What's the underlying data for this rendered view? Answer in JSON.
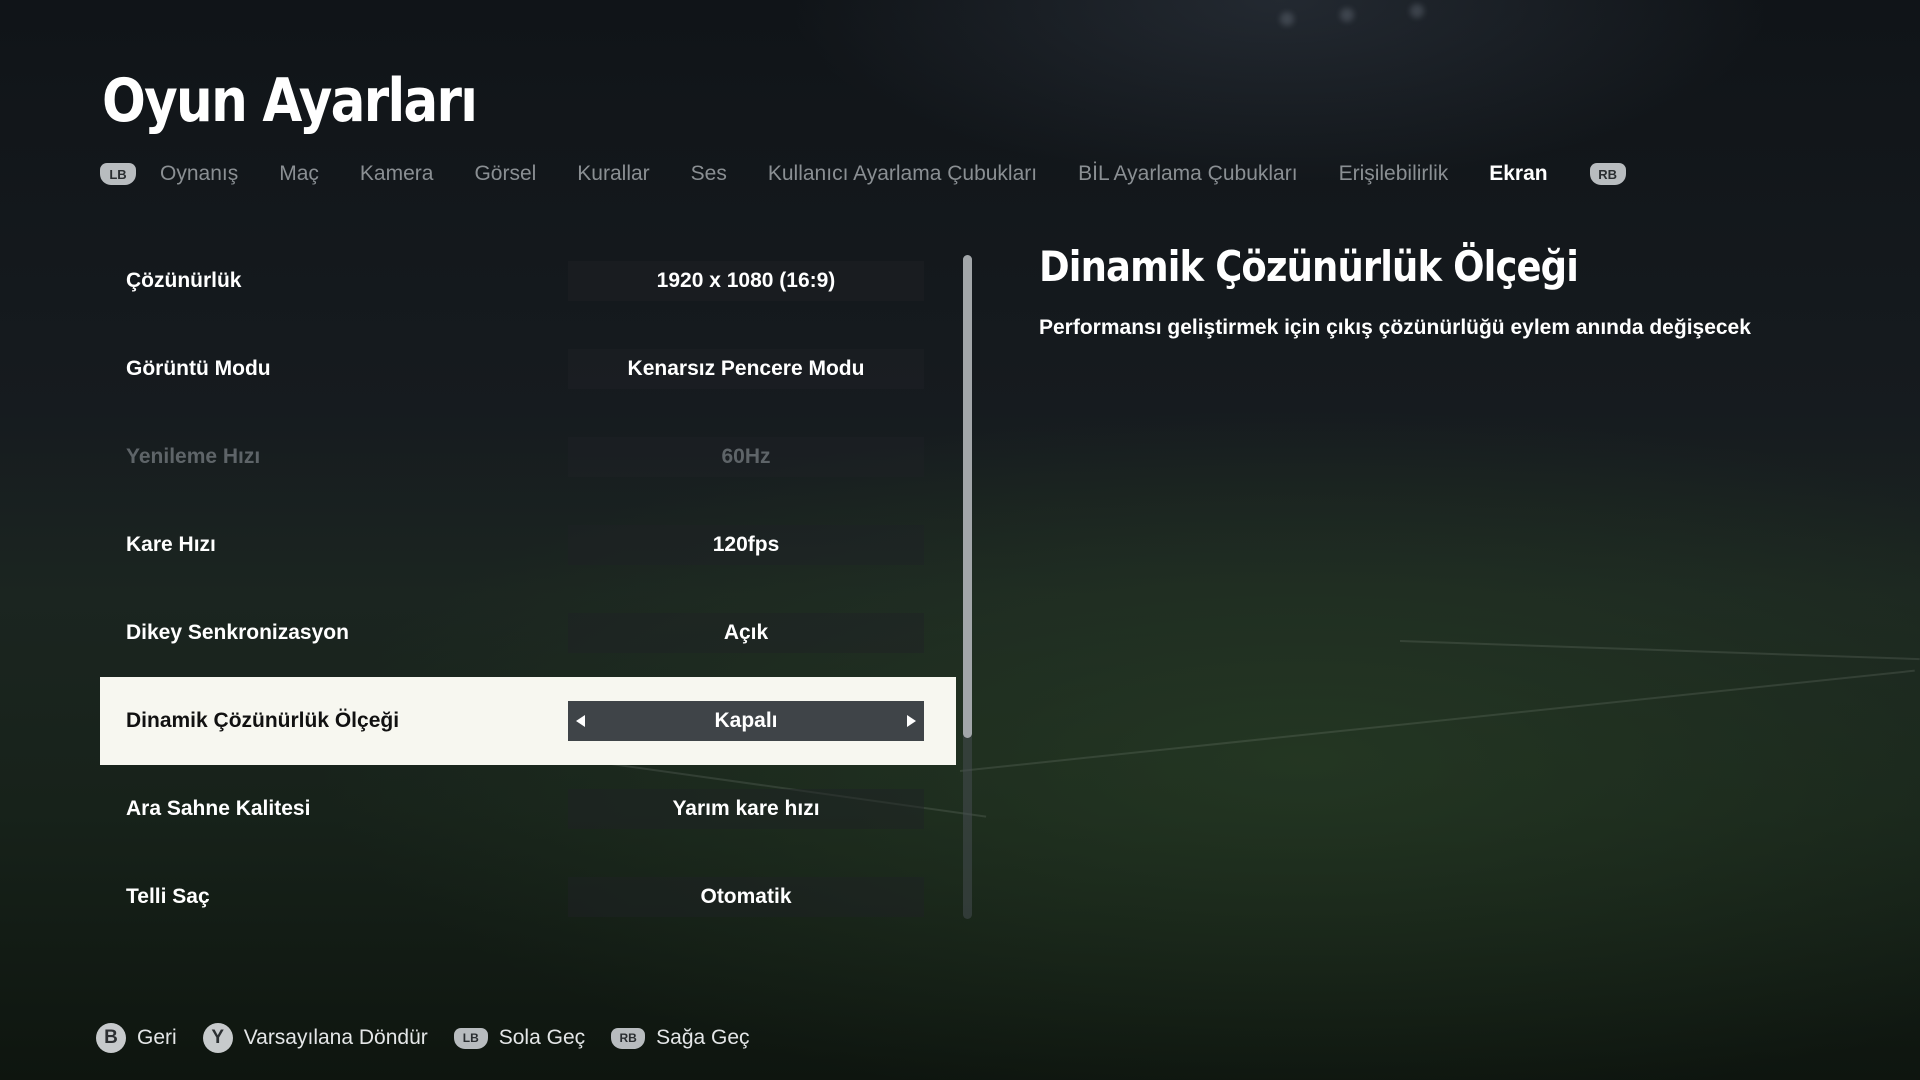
{
  "page": {
    "title": "Oyun Ayarları"
  },
  "tabs": {
    "left_bumper": "LB",
    "right_bumper": "RB",
    "items": [
      {
        "label": "Oynanış",
        "active": false
      },
      {
        "label": "Maç",
        "active": false
      },
      {
        "label": "Kamera",
        "active": false
      },
      {
        "label": "Görsel",
        "active": false
      },
      {
        "label": "Kurallar",
        "active": false
      },
      {
        "label": "Ses",
        "active": false
      },
      {
        "label": "Kullanıcı Ayarlama Çubukları",
        "active": false
      },
      {
        "label": "BİL Ayarlama Çubukları",
        "active": false
      },
      {
        "label": "Erişilebilirlik",
        "active": false
      },
      {
        "label": "Ekran",
        "active": true
      }
    ]
  },
  "settings": [
    {
      "label": "Çözünürlük",
      "value": "1920 x 1080 (16:9)",
      "state": "normal"
    },
    {
      "label": "Görüntü Modu",
      "value": "Kenarsız Pencere Modu",
      "state": "normal"
    },
    {
      "label": "Yenileme Hızı",
      "value": "60Hz",
      "state": "disabled"
    },
    {
      "label": "Kare Hızı",
      "value": "120fps",
      "state": "normal"
    },
    {
      "label": "Dikey Senkronizasyon",
      "value": "Açık",
      "state": "normal"
    },
    {
      "label": "Dinamik Çözünürlük Ölçeği",
      "value": "Kapalı",
      "state": "selected"
    },
    {
      "label": "Ara Sahne Kalitesi",
      "value": "Yarım kare hızı",
      "state": "normal"
    },
    {
      "label": "Telli Saç",
      "value": "Otomatik",
      "state": "normal"
    }
  ],
  "detail": {
    "title": "Dinamik Çözünürlük Ölçeği",
    "description": "Performansı geliştirmek için çıkış çözünürlüğü eylem anında değişecek"
  },
  "footer": {
    "hints": [
      {
        "button": "B",
        "type": "face",
        "label": "Geri"
      },
      {
        "button": "Y",
        "type": "face",
        "label": "Varsayılana Döndür"
      },
      {
        "button": "LB",
        "type": "bumper",
        "label": "Sola Geç"
      },
      {
        "button": "RB",
        "type": "bumper",
        "label": "Sağa Geç"
      }
    ]
  },
  "colors": {
    "selected_row_bg": "#f7f7f0",
    "active_tab": "#ffffff",
    "inactive_tab": "#8a8f93",
    "disabled_text": "#5e6468"
  },
  "icons": [
    "lb-bumper-icon",
    "rb-bumper-icon",
    "chevron-left-icon",
    "chevron-right-icon",
    "b-button-icon",
    "y-button-icon"
  ]
}
